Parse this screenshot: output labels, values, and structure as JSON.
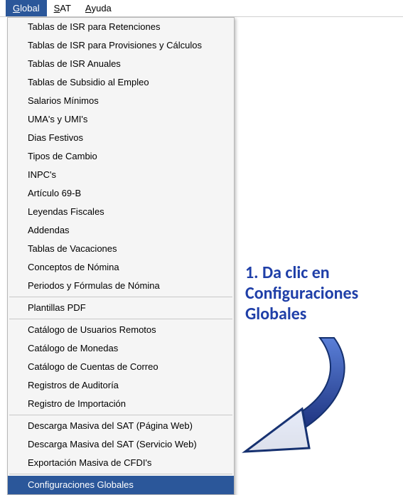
{
  "menubar": {
    "items": [
      {
        "label": "Global",
        "underline_index": 0,
        "active": true
      },
      {
        "label": "SAT",
        "underline_index": 0,
        "active": false
      },
      {
        "label": "Ayuda",
        "underline_index": 0,
        "active": false
      }
    ]
  },
  "dropdown": {
    "groups": [
      {
        "items": [
          "Tablas de ISR para Retenciones",
          "Tablas de ISR para Provisiones y Cálculos",
          "Tablas de ISR Anuales",
          "Tablas de Subsidio al Empleo",
          "Salarios Mínimos",
          "UMA's y UMI's",
          "Dias Festivos",
          "Tipos de Cambio",
          "INPC's",
          "Artículo 69-B",
          "Leyendas Fiscales",
          "Addendas",
          "Tablas de Vacaciones",
          "Conceptos de Nómina",
          "Periodos y Fórmulas de Nómina"
        ]
      },
      {
        "items": [
          "Plantillas PDF"
        ]
      },
      {
        "items": [
          "Catálogo de Usuarios Remotos",
          "Catálogo de Monedas",
          "Catálogo de Cuentas de Correo",
          "Registros de Auditoría",
          "Registro de Importación"
        ]
      },
      {
        "items": [
          "Descarga Masiva del SAT (Página Web)",
          "Descarga Masiva del SAT (Servicio Web)",
          "Exportación Masiva de CFDI's"
        ]
      },
      {
        "items": [
          "Configuraciones Globales"
        ],
        "selected_index": 0
      }
    ]
  },
  "annotation": {
    "text": "1. Da clic en Configuraciones Globales",
    "color": "#1f3fa8"
  }
}
